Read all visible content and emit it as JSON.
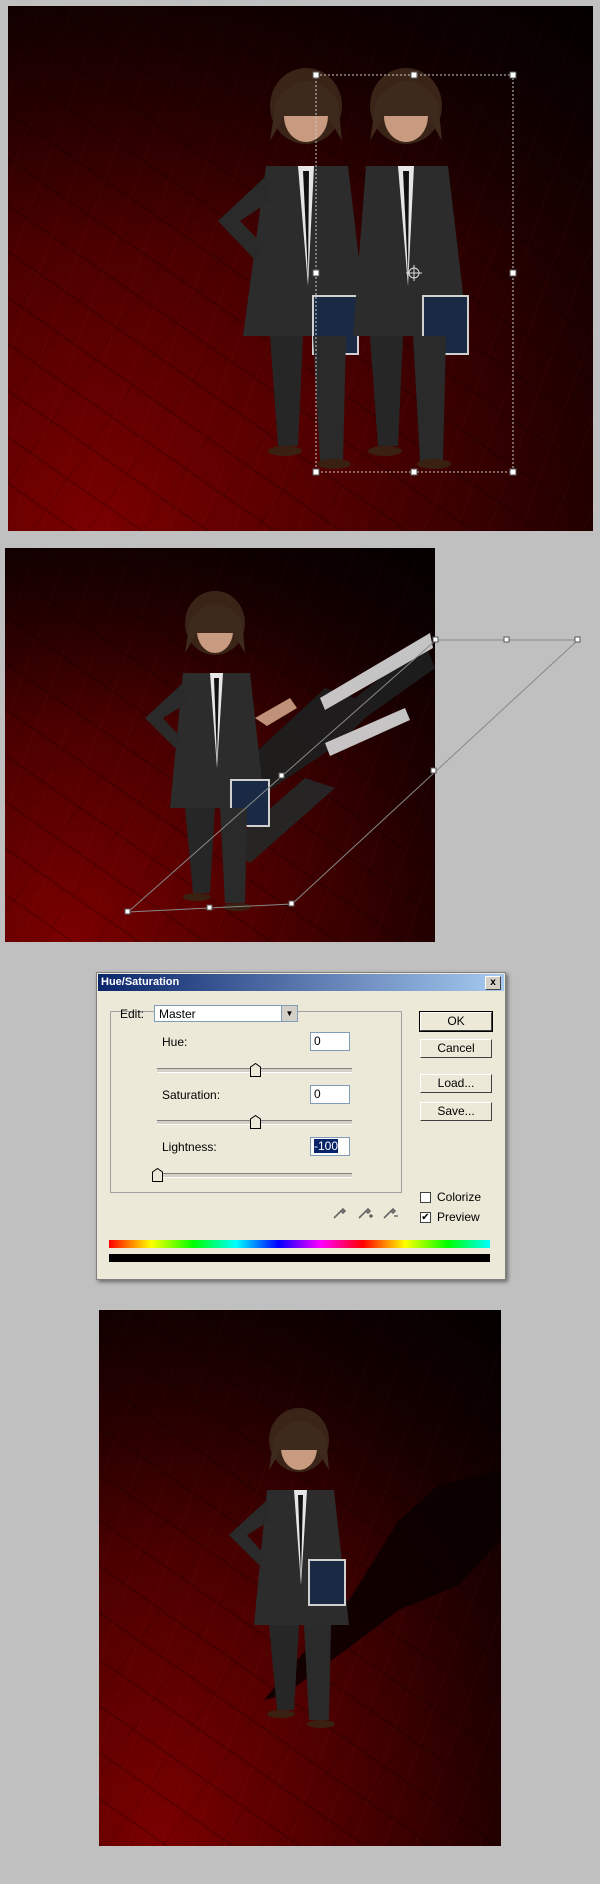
{
  "dialog": {
    "title": "Hue/Saturation",
    "close_glyph": "x",
    "edit_label": "Edit:",
    "edit_value": "Master",
    "hue_label": "Hue:",
    "hue_value": "0",
    "saturation_label": "Saturation:",
    "saturation_value": "0",
    "lightness_label": "Lightness:",
    "lightness_value": "-100",
    "ok_label": "OK",
    "cancel_label": "Cancel",
    "load_label": "Load...",
    "save_label": "Save...",
    "colorize_label": "Colorize",
    "colorize_checked": false,
    "preview_label": "Preview",
    "preview_checked": true,
    "preview_check_glyph": "✔",
    "hue_slider_level": 0.5,
    "saturation_slider_level": 0.5,
    "lightness_slider_level": 0.0,
    "icons": [
      "eyedropper-icon",
      "eyedropper-plus-icon",
      "eyedropper-minus-icon"
    ]
  },
  "colors": {
    "titlebar_start": "#0a246a",
    "titlebar_end": "#a6caf0",
    "canvas_red": "#7a0000",
    "selection_highlight": "#0a246a"
  }
}
